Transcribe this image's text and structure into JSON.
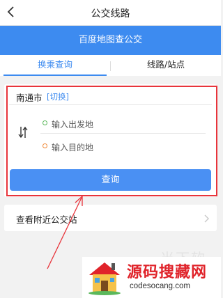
{
  "header": {
    "title": "公交线路",
    "back_icon": "back-chevron-icon"
  },
  "banner": {
    "text": "百度地图查公交"
  },
  "tabs": [
    {
      "label": "换乘查询",
      "active": true
    },
    {
      "label": "线路/站点",
      "active": false
    }
  ],
  "search": {
    "city": "南通市",
    "switch_label": "[切换]",
    "from_placeholder": "输入出发地",
    "to_placeholder": "输入目的地",
    "query_button": "查询"
  },
  "nearby": {
    "label": "查看附近公交站"
  },
  "watermark": {
    "text": "当下软件园"
  },
  "logo": {
    "cn_text": "源码搜藏网",
    "en_text": "codesocang.com"
  },
  "colors": {
    "accent": "#3d8bf0",
    "highlight": "#e8343b",
    "logo_red": "#e0232a"
  }
}
